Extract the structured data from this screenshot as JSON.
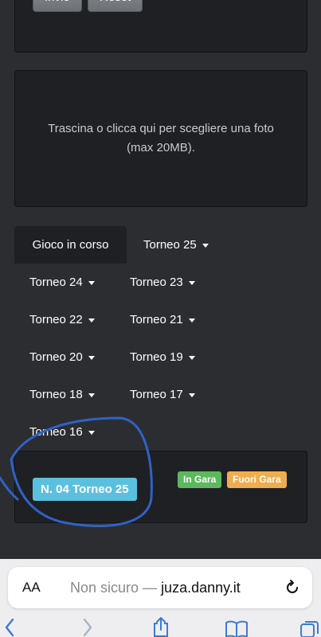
{
  "form": {
    "submit_label": "Invio",
    "reset_label": "Reset"
  },
  "upload": {
    "prompt": "Trascina o clicca qui per scegliere una foto (max 20MB)."
  },
  "tabs": {
    "active": "Gioco in corso",
    "dropdowns": [
      "Torneo 25",
      "Torneo 24",
      "Torneo 23",
      "Torneo 22",
      "Torneo 21",
      "Torneo 20",
      "Torneo 19",
      "Torneo 18",
      "Torneo 17",
      "Torneo 16"
    ]
  },
  "result": {
    "entry_label": "N. 04 Torneo 25",
    "in_gara_label": "In Gara",
    "fuori_gara_label": "Fuori Gara"
  },
  "browser": {
    "aa_label": "AA",
    "security_text": "Non sicuro —",
    "host": "juza.danny.it"
  },
  "colors": {
    "background": "#2b2d31",
    "panel": "#1f2024",
    "label_info": "#5bc0de",
    "label_success": "#5cb85c",
    "label_warning": "#f0ad4e",
    "annotation_stroke": "#2f62c8",
    "safari_accent": "#3a7bd5"
  },
  "icons": [
    "caret-down-icon",
    "reload-icon",
    "back-icon",
    "forward-icon",
    "share-icon",
    "bookmarks-icon",
    "tabs-icon"
  ]
}
